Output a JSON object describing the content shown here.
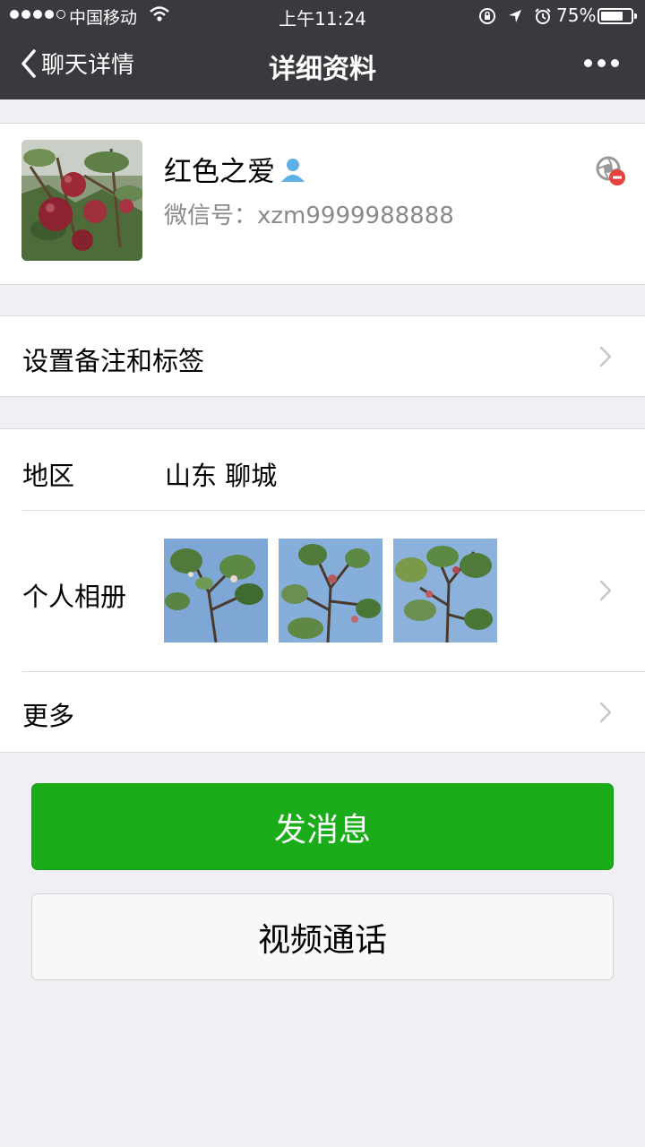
{
  "status": {
    "carrier": "中国移动",
    "time": "上午11:24",
    "battery": "75%",
    "battery_level": 0.75
  },
  "nav": {
    "back_label": "聊天详情",
    "title": "详细资料"
  },
  "profile": {
    "name": "红色之爱",
    "wechat_id": "微信号：xzm9999988888"
  },
  "remark": {
    "label": "设置备注和标签"
  },
  "region": {
    "label": "地区",
    "value": "山东  聊城"
  },
  "album": {
    "label": "个人相册"
  },
  "more": {
    "label": "更多"
  },
  "actions": {
    "send_message": "发消息",
    "video_call": "视频通话"
  },
  "colors": {
    "nav_bg": "#39393e",
    "primary_green": "#1aad19",
    "page_bg": "#efeff4"
  }
}
